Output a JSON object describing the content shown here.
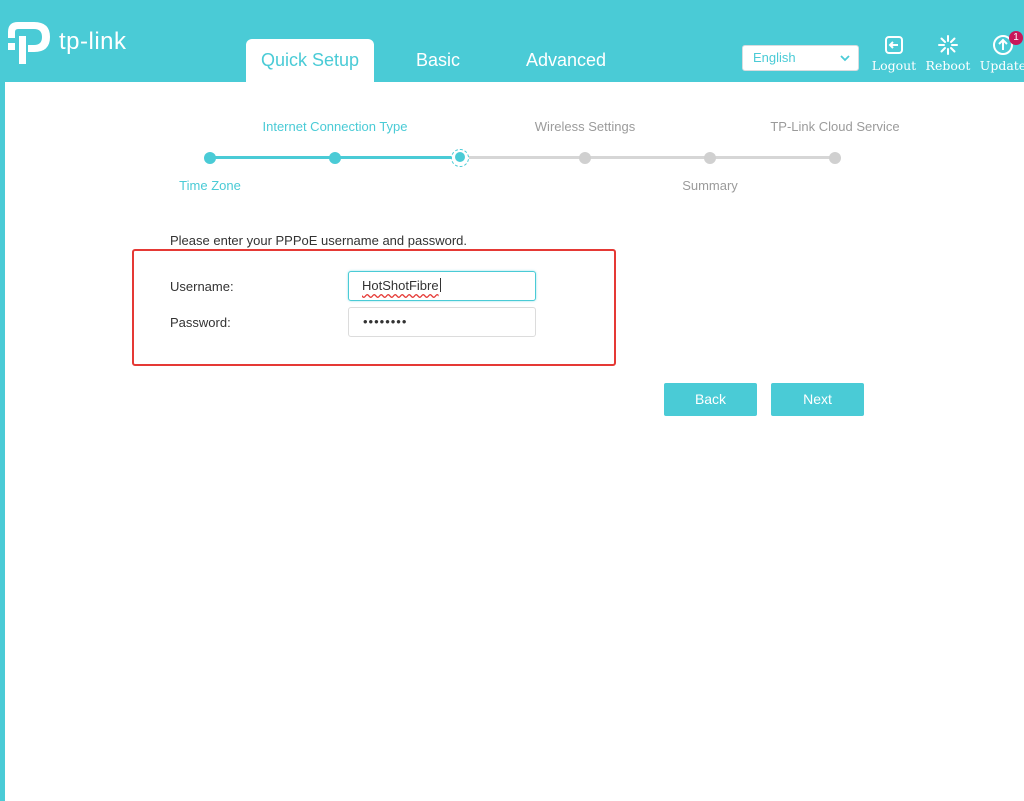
{
  "brand": {
    "logo_text": "tp-link",
    "color": "#4acbd6"
  },
  "nav": {
    "tabs": [
      {
        "label": "Quick Setup",
        "active": true
      },
      {
        "label": "Basic",
        "active": false
      },
      {
        "label": "Advanced",
        "active": false
      }
    ]
  },
  "header": {
    "language": "English",
    "actions": [
      {
        "label": "Logout",
        "icon": "logout-icon"
      },
      {
        "label": "Reboot",
        "icon": "reboot-icon"
      },
      {
        "label": "Update",
        "icon": "update-icon",
        "badge": "1"
      }
    ]
  },
  "wizard": {
    "steps": [
      {
        "label": "Time Zone",
        "state": "done"
      },
      {
        "label": "Internet Connection Type",
        "state": "done"
      },
      {
        "label": "",
        "state": "current"
      },
      {
        "label": "Wireless Settings",
        "state": "todo"
      },
      {
        "label": "Summary",
        "state": "todo"
      },
      {
        "label": "TP-Link Cloud Service",
        "state": "todo"
      }
    ]
  },
  "form": {
    "instruction": "Please enter your PPPoE username and password.",
    "username_label": "Username:",
    "username_value": "HotShotFibre",
    "password_label": "Password:",
    "password_value": "••••••••"
  },
  "buttons": {
    "back": "Back",
    "next": "Next"
  },
  "colors": {
    "accent": "#4acbd6",
    "highlight": "#e53935",
    "badge": "#c8175a",
    "inactive": "#d0d0d0"
  }
}
